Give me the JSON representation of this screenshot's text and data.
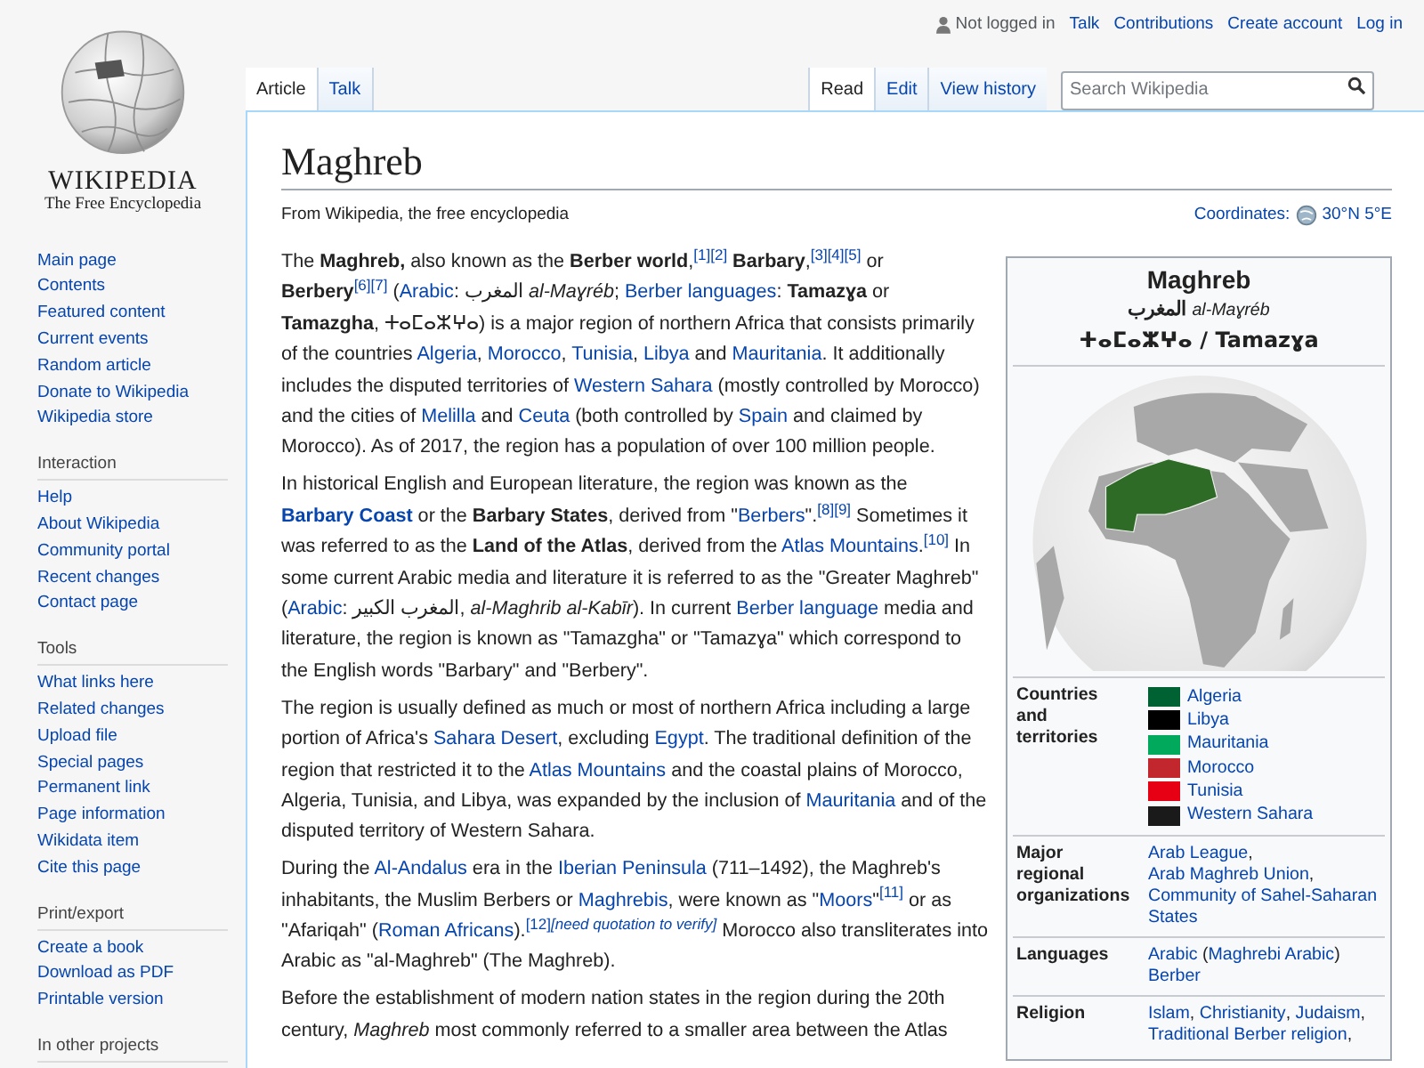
{
  "personal_tools": {
    "status": "Not logged in",
    "links": [
      "Talk",
      "Contributions",
      "Create account",
      "Log in"
    ]
  },
  "logo": {
    "wordmark": "WIKIPEDIA",
    "tagline": "The Free Encyclopedia"
  },
  "sidebar": {
    "sections": [
      {
        "items": [
          "Main page",
          "Contents",
          "Featured content",
          "Current events",
          "Random article",
          "Donate to Wikipedia",
          "Wikipedia store"
        ]
      },
      {
        "heading": "Interaction",
        "items": [
          "Help",
          "About Wikipedia",
          "Community portal",
          "Recent changes",
          "Contact page"
        ]
      },
      {
        "heading": "Tools",
        "items": [
          "What links here",
          "Related changes",
          "Upload file",
          "Special pages",
          "Permanent link",
          "Page information",
          "Wikidata item",
          "Cite this page"
        ]
      },
      {
        "heading": "Print/export",
        "items": [
          "Create a book",
          "Download as PDF",
          "Printable version"
        ]
      },
      {
        "heading": "In other projects"
      }
    ]
  },
  "page_tabs": [
    {
      "label": "Article",
      "selected": true
    },
    {
      "label": "Talk",
      "selected": false
    }
  ],
  "view_tabs": [
    {
      "label": "Read",
      "selected": true
    },
    {
      "label": "Edit",
      "selected": false
    },
    {
      "label": "View history",
      "selected": false
    }
  ],
  "search": {
    "placeholder": "Search Wikipedia"
  },
  "article": {
    "title": "Maghreb",
    "tagline": "From Wikipedia, the free encyclopedia",
    "coordinates": {
      "label": "Coordinates:",
      "value": "30°N 5°E"
    },
    "paragraphs": [
      [
        {
          "kind": "text",
          "text": "The "
        },
        {
          "kind": "bold",
          "text": "Maghreb,"
        },
        {
          "kind": "text",
          "text": " also known as the "
        },
        {
          "kind": "bold",
          "text": "Berber world"
        },
        {
          "kind": "text",
          "text": ","
        },
        {
          "kind": "ref",
          "text": "[1][2]"
        },
        {
          "kind": "bold",
          "text": " Barbary"
        },
        {
          "kind": "text",
          "text": ","
        },
        {
          "kind": "ref",
          "text": "[3][4][5]"
        },
        {
          "kind": "text",
          "text": " or "
        },
        {
          "kind": "bold",
          "text": "Berbery"
        },
        {
          "kind": "ref",
          "text": "[6][7]"
        },
        {
          "kind": "text",
          "text": " ("
        },
        {
          "kind": "link",
          "text": "Arabic"
        },
        {
          "kind": "text",
          "text": ": المغرب "
        },
        {
          "kind": "italic",
          "text": "al-Maɣréb"
        },
        {
          "kind": "text",
          "text": "; "
        },
        {
          "kind": "link",
          "text": "Berber languages"
        },
        {
          "kind": "text",
          "text": ": "
        },
        {
          "kind": "bold",
          "text": "Tamazɣa"
        },
        {
          "kind": "text",
          "text": " or "
        },
        {
          "kind": "bold",
          "text": "Tamazgha"
        },
        {
          "kind": "text",
          "text": ", ⵜⴰⵎⴰⵣⵖⴰ) is a major region of northern Africa that consists primarily of the countries "
        },
        {
          "kind": "link",
          "text": "Algeria"
        },
        {
          "kind": "text",
          "text": ", "
        },
        {
          "kind": "link",
          "text": "Morocco"
        },
        {
          "kind": "text",
          "text": ", "
        },
        {
          "kind": "link",
          "text": "Tunisia"
        },
        {
          "kind": "text",
          "text": ", "
        },
        {
          "kind": "link",
          "text": "Libya"
        },
        {
          "kind": "text",
          "text": " and "
        },
        {
          "kind": "link",
          "text": "Mauritania"
        },
        {
          "kind": "text",
          "text": ". It additionally includes the disputed territories of "
        },
        {
          "kind": "link",
          "text": "Western Sahara"
        },
        {
          "kind": "text",
          "text": " (mostly controlled by Morocco) and the cities of "
        },
        {
          "kind": "link",
          "text": "Melilla"
        },
        {
          "kind": "text",
          "text": " and "
        },
        {
          "kind": "link",
          "text": "Ceuta"
        },
        {
          "kind": "text",
          "text": " (both controlled by "
        },
        {
          "kind": "link",
          "text": "Spain"
        },
        {
          "kind": "text",
          "text": " and claimed by Morocco). As of 2017, the region has a population of over 100 million people."
        }
      ],
      [
        {
          "kind": "text",
          "text": "In historical English and European literature, the region was known as the "
        },
        {
          "kind": "boldlink",
          "text": "Barbary Coast"
        },
        {
          "kind": "text",
          "text": " or the "
        },
        {
          "kind": "bold",
          "text": "Barbary States"
        },
        {
          "kind": "text",
          "text": ", derived from \""
        },
        {
          "kind": "link",
          "text": "Berbers"
        },
        {
          "kind": "text",
          "text": "\"."
        },
        {
          "kind": "ref",
          "text": "[8][9]"
        },
        {
          "kind": "text",
          "text": " Sometimes it was referred to as the "
        },
        {
          "kind": "bold",
          "text": "Land of the Atlas"
        },
        {
          "kind": "text",
          "text": ", derived from the "
        },
        {
          "kind": "link",
          "text": "Atlas Mountains"
        },
        {
          "kind": "text",
          "text": "."
        },
        {
          "kind": "ref",
          "text": "[10]"
        },
        {
          "kind": "text",
          "text": " In some current Arabic media and literature it is referred to as the \"Greater Maghreb\" ("
        },
        {
          "kind": "link",
          "text": "Arabic"
        },
        {
          "kind": "text",
          "text": ": المغرب الكبير, "
        },
        {
          "kind": "italic",
          "text": "al-Maghrib al-Kabīr"
        },
        {
          "kind": "text",
          "text": "). In current "
        },
        {
          "kind": "link",
          "text": "Berber language"
        },
        {
          "kind": "text",
          "text": " media and literature, the region is known as \"Tamazgha\" or \"Tamazɣa\" which correspond to the English words \"Barbary\" and \"Berbery\"."
        }
      ],
      [
        {
          "kind": "text",
          "text": "The region is usually defined as much or most of northern Africa including a large portion of Africa's "
        },
        {
          "kind": "link",
          "text": "Sahara Desert"
        },
        {
          "kind": "text",
          "text": ", excluding "
        },
        {
          "kind": "link",
          "text": "Egypt"
        },
        {
          "kind": "text",
          "text": ". The traditional definition of the region that restricted it to the "
        },
        {
          "kind": "link",
          "text": "Atlas Mountains"
        },
        {
          "kind": "text",
          "text": " and the coastal plains of Morocco, Algeria, Tunisia, and Libya, was expanded by the inclusion of "
        },
        {
          "kind": "link",
          "text": "Mauritania"
        },
        {
          "kind": "text",
          "text": " and of the disputed territory of Western Sahara."
        }
      ],
      [
        {
          "kind": "text",
          "text": "During the "
        },
        {
          "kind": "link",
          "text": "Al-Andalus"
        },
        {
          "kind": "text",
          "text": " era in the "
        },
        {
          "kind": "link",
          "text": "Iberian Peninsula"
        },
        {
          "kind": "text",
          "text": " (711–1492), the Maghreb's inhabitants, the Muslim Berbers or "
        },
        {
          "kind": "link",
          "text": "Maghrebis"
        },
        {
          "kind": "text",
          "text": ", were known as \""
        },
        {
          "kind": "link",
          "text": "Moors"
        },
        {
          "kind": "text",
          "text": "\""
        },
        {
          "kind": "ref",
          "text": "[11]"
        },
        {
          "kind": "text",
          "text": " or as \"Afariqah\" ("
        },
        {
          "kind": "link",
          "text": "Roman Africans"
        },
        {
          "kind": "text",
          "text": ")."
        },
        {
          "kind": "ref",
          "text": "[12]"
        },
        {
          "kind": "note",
          "text": "[need quotation to verify]"
        },
        {
          "kind": "text",
          "text": " Morocco also transliterates into Arabic as \"al-Maghreb\" (The Maghreb)."
        }
      ],
      [
        {
          "kind": "text",
          "text": "Before the establishment of modern nation states in the region during the 20th century, "
        },
        {
          "kind": "italic",
          "text": "Maghreb"
        },
        {
          "kind": "text",
          "text": " most commonly referred to a smaller area between the Atlas"
        }
      ]
    ]
  },
  "infobox": {
    "title": "Maghreb",
    "native_arabic": "المغرب",
    "native_latin": "al-Maɣréb",
    "native_tifinagh": "ⵜⴰⵎⴰⵣⵖⴰ / Tamazɣa",
    "rows": [
      {
        "kind": "flags",
        "label": "Countries and territories",
        "items": [
          {
            "name": "Algeria",
            "color": "#006233"
          },
          {
            "name": "Libya",
            "color": "#000000"
          },
          {
            "name": "Mauritania",
            "color": "#00a95c"
          },
          {
            "name": "Morocco",
            "color": "#c1272d"
          },
          {
            "name": "Tunisia",
            "color": "#e70013"
          },
          {
            "name": "Western Sahara",
            "color": "#1a1a1a"
          }
        ]
      },
      {
        "kind": "text",
        "label": "Major regional organizations",
        "value": [
          {
            "kind": "link",
            "text": "Arab League"
          },
          {
            "kind": "text",
            "text": ", "
          },
          {
            "kind": "link",
            "text": "Arab Maghreb Union"
          },
          {
            "kind": "text",
            "text": ", "
          },
          {
            "kind": "link",
            "text": "Community of Sahel-Saharan States"
          }
        ]
      },
      {
        "kind": "text",
        "label": "Languages",
        "value": [
          {
            "kind": "link",
            "text": "Arabic"
          },
          {
            "kind": "text",
            "text": " ("
          },
          {
            "kind": "link",
            "text": "Maghrebi Arabic"
          },
          {
            "kind": "text",
            "text": ") "
          },
          {
            "kind": "link",
            "text": "Berber"
          }
        ]
      },
      {
        "kind": "text",
        "label": "Religion",
        "value": [
          {
            "kind": "link",
            "text": "Islam"
          },
          {
            "kind": "text",
            "text": ", "
          },
          {
            "kind": "link",
            "text": "Christianity"
          },
          {
            "kind": "text",
            "text": ", "
          },
          {
            "kind": "link",
            "text": "Judaism"
          },
          {
            "kind": "text",
            "text": ", "
          },
          {
            "kind": "link",
            "text": "Traditional Berber religion"
          },
          {
            "kind": "text",
            "text": ","
          }
        ]
      }
    ]
  }
}
